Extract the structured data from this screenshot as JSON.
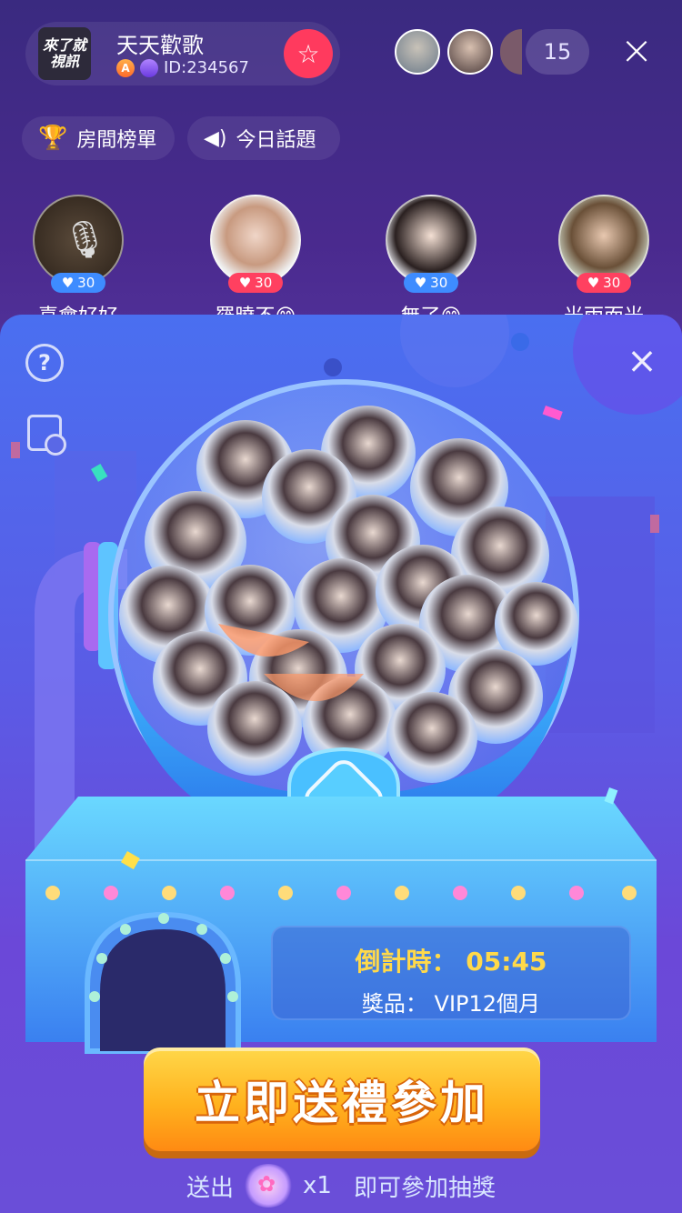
{
  "room": {
    "logo_text": "來了就 視訊",
    "name": "天天歡歌",
    "level_badge": "A",
    "id_text": "ID:234567",
    "follow_icon": "star-icon"
  },
  "viewers": {
    "count": "15"
  },
  "chips": {
    "rank_label": "房間榜單",
    "topic_label": "今日話題"
  },
  "seats": [
    {
      "name": "喜會好好",
      "score": "30",
      "score_color": "#3e8cff",
      "muted": true
    },
    {
      "name": "羅曉不😊",
      "score": "30",
      "score_color": "#ff4060",
      "muted": false
    },
    {
      "name": "無了😊",
      "score": "30",
      "score_color": "#3e8cff",
      "muted": false
    },
    {
      "name": "光雨而光",
      "score": "30",
      "score_color": "#ff4060",
      "muted": false
    }
  ],
  "panel": {
    "help_icon": "help-icon",
    "record_icon": "record-icon",
    "countdown": "倒計時： 05:45",
    "prize": "獎品： VIP12個月",
    "cta_label": "立即送禮參加",
    "footer_prefix": "送出",
    "footer_qty": "x1",
    "footer_suffix": "即可參加抽獎"
  },
  "colors": {
    "accent": "#ffd94a",
    "cta": "#ffb21e",
    "follow": "#ff3a5e"
  }
}
